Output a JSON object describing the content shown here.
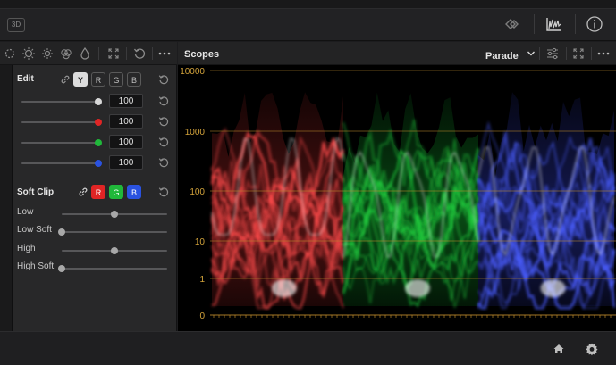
{
  "app": {
    "badge": "3D"
  },
  "left_panel": {
    "edit_label": "Edit",
    "channels": [
      "Y",
      "R",
      "G",
      "B"
    ],
    "sliders": [
      {
        "value": "100",
        "color": "#d8d8d8"
      },
      {
        "value": "100",
        "color": "#e02525"
      },
      {
        "value": "100",
        "color": "#20b83a"
      },
      {
        "value": "100",
        "color": "#2a52e0"
      }
    ],
    "soft_clip_label": "Soft Clip",
    "soft_clip_channels": [
      "R",
      "G",
      "B"
    ],
    "soft_clip_rows": [
      {
        "label": "Low",
        "level": 0.5
      },
      {
        "label": "Low Soft",
        "level": 0.0
      },
      {
        "label": "High",
        "level": 0.5
      },
      {
        "label": "High Soft",
        "level": 0.0
      }
    ]
  },
  "scopes": {
    "title": "Scopes",
    "mode": "Parade",
    "axis_labels": [
      "10000",
      "1000",
      "100",
      "10",
      "1",
      "0"
    ],
    "colors": {
      "red": "#ff4a4a",
      "green": "#22d43f",
      "blue": "#4a5dff",
      "grid": "#b8862a"
    }
  },
  "icons": {
    "top": [
      "viewer-mode-icon",
      "scopes-icon",
      "info-icon"
    ],
    "bottom": [
      "home-icon",
      "settings-icon"
    ]
  }
}
